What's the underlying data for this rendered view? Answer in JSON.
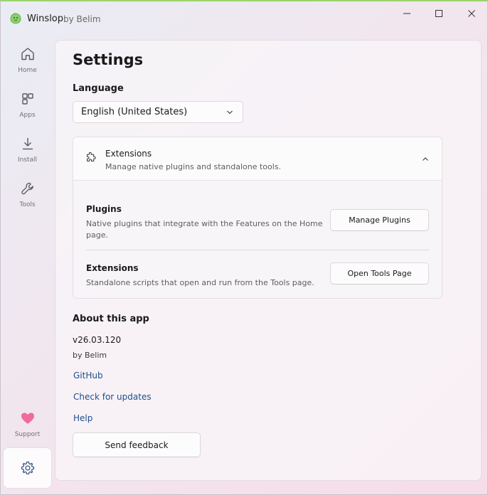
{
  "app": {
    "title": "Winslop",
    "subtitle": "by Belim",
    "accent": "#8bd06a"
  },
  "nav": {
    "items": [
      {
        "label": "Home",
        "icon": "home-icon"
      },
      {
        "label": "Apps",
        "icon": "apps-icon"
      },
      {
        "label": "Install",
        "icon": "download-icon"
      },
      {
        "label": "Tools",
        "icon": "wrench-icon"
      }
    ],
    "support": {
      "label": "Support",
      "icon": "heart-icon",
      "color": "#ef6c9a"
    },
    "settings": {
      "icon": "gear-icon"
    }
  },
  "settings": {
    "title": "Settings",
    "language": {
      "label": "Language",
      "selected": "English (United States)"
    },
    "extensions": {
      "title": "Extensions",
      "description": "Manage native plugins and standalone tools.",
      "rows": [
        {
          "title": "Plugins",
          "description": "Native plugins that integrate with the Features on the Home page.",
          "button": "Manage Plugins"
        },
        {
          "title": "Extensions",
          "description": "Standalone scripts that open and run from the Tools page.",
          "button": "Open Tools Page"
        }
      ]
    },
    "about": {
      "label": "About this app",
      "version": "v26.03.120",
      "by": "by Belim",
      "links": [
        "GitHub",
        "Check for updates",
        "Help"
      ],
      "feedback_button": "Send feedback"
    }
  },
  "colors": {
    "link": "#1d4f8c"
  }
}
